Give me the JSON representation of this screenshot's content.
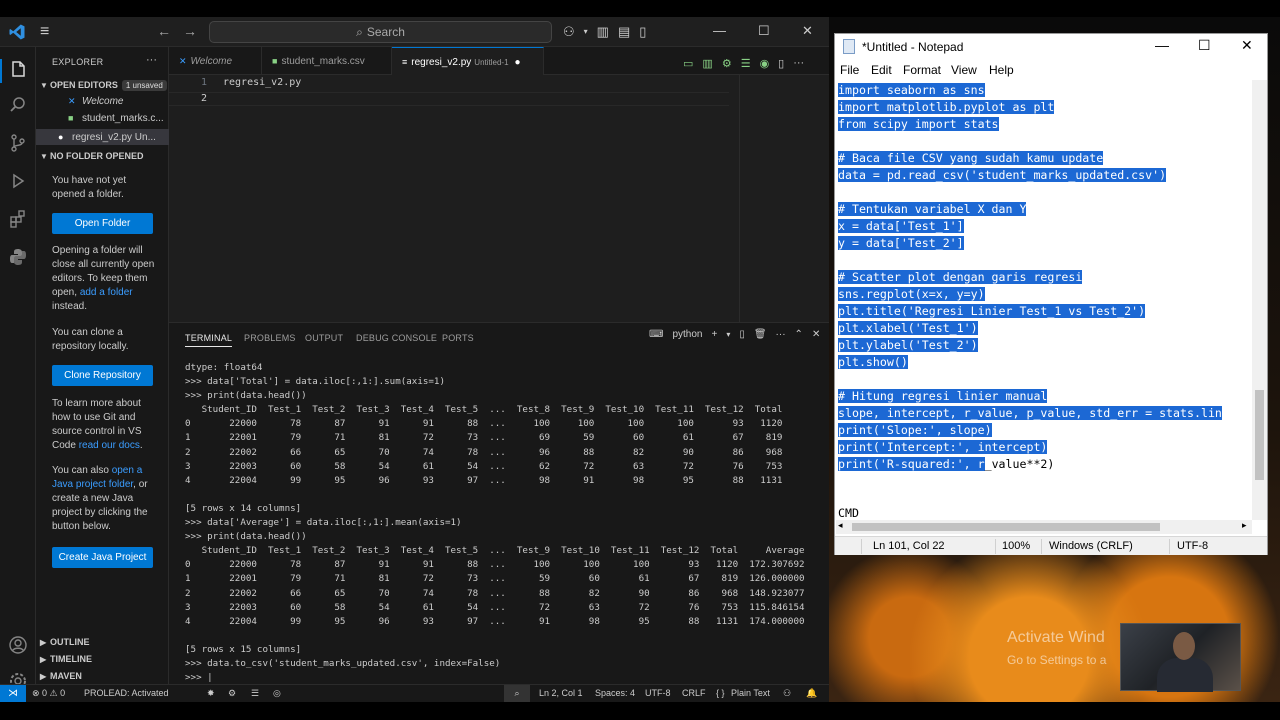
{
  "vscode": {
    "title_search": "Search",
    "explorer": {
      "title": "EXPLORER",
      "open_editors": "OPEN EDITORS",
      "unsaved_badge": "1 unsaved",
      "files": [
        "Welcome",
        "student_marks.c...",
        "regresi_v2.py Un..."
      ],
      "no_folder": "NO FOLDER OPENED",
      "msg_not_opened": "You have not yet opened a folder.",
      "open_folder_btn": "Open Folder",
      "msg_opening_1": "Opening a folder will close all currently open editors. To keep them open, ",
      "msg_opening_link": "add a folder",
      "msg_opening_2": " instead.",
      "msg_clone": "You can clone a repository locally.",
      "clone_btn": "Clone Repository",
      "msg_git_1": "To learn more about how to use Git and source control in VS Code ",
      "msg_git_link": "read our docs",
      "msg_git_2": ".",
      "msg_java_1": "You can also ",
      "msg_java_link": "open a Java project folder",
      "msg_java_2": ", or create a new Java project by clicking the button below.",
      "java_btn": "Create Java Project",
      "outline": "OUTLINE",
      "timeline": "TIMELINE",
      "maven": "MAVEN"
    },
    "tabs": {
      "welcome": "Welcome",
      "csv": "student_marks.csv",
      "py": "regresi_v2.py",
      "py_sub": "Untitled-1"
    },
    "editor": {
      "lines": [
        "regresi_v2.py",
        ""
      ]
    },
    "panel": {
      "tabs": [
        "TERMINAL",
        "PROBLEMS",
        "OUTPUT",
        "DEBUG CONSOLE",
        "PORTS"
      ],
      "shell": "python",
      "lines": [
        "dtype: float64",
        ">>> data['Total'] = data.iloc[:,1:].sum(axis=1)",
        ">>> print(data.head())",
        "   Student_ID  Test_1  Test_2  Test_3  Test_4  Test_5  ...  Test_8  Test_9  Test_10  Test_11  Test_12  Total",
        "0       22000      78      87      91      91      88  ...     100     100      100      100       93   1120",
        "1       22001      79      71      81      72      73  ...      69      59       60       61       67    819",
        "2       22002      66      65      70      74      78  ...      96      88       82       90       86    968",
        "3       22003      60      58      54      61      54  ...      62      72       63       72       76    753",
        "4       22004      99      95      96      93      97  ...      98      91       98       95       88   1131",
        "",
        "[5 rows x 14 columns]",
        ">>> data['Average'] = data.iloc[:,1:].mean(axis=1)",
        ">>> print(data.head())",
        "   Student_ID  Test_1  Test_2  Test_3  Test_4  Test_5  ...  Test_9  Test_10  Test_11  Test_12  Total     Average",
        "0       22000      78      87      91      91      88  ...     100      100      100       93   1120  172.307692",
        "1       22001      79      71      81      72      73  ...      59       60       61       67    819  126.000000",
        "2       22002      66      65      70      74      78  ...      88       82       90       86    968  148.923077",
        "3       22003      60      58      54      61      54  ...      72       63       72       76    753  115.846154",
        "4       22004      99      95      96      93      97  ...      91       98       95       88   1131  174.000000",
        "",
        "[5 rows x 15 columns]",
        ">>> data.to_csv('student_marks_updated.csv', index=False)",
        ">>> |"
      ]
    },
    "status": {
      "errors": "⊗ 0 ⚠ 0",
      "prolead": "PROLEAD: Activated",
      "pos": "Ln 2, Col 1",
      "spaces": "Spaces: 4",
      "enc": "UTF-8",
      "eol": "CRLF",
      "lang": "Plain Text"
    }
  },
  "notepad": {
    "title": "*Untitled - Notepad",
    "menu": [
      "File",
      "Edit",
      "Format",
      "View",
      "Help"
    ],
    "lines": [
      {
        "text": "import seaborn as sns",
        "hl": true
      },
      {
        "text": "import matplotlib.pyplot as plt",
        "hl": true
      },
      {
        "text": "from scipy import stats",
        "hl": true
      },
      {
        "text": "",
        "hl": true
      },
      {
        "text": "# Baca file CSV yang sudah kamu update",
        "hl": true
      },
      {
        "text": "data = pd.read_csv('student_marks_updated.csv')",
        "hl": true
      },
      {
        "text": "",
        "hl": true
      },
      {
        "text": "# Tentukan variabel X dan Y",
        "hl": true
      },
      {
        "text": "x = data['Test_1']",
        "hl": true
      },
      {
        "text": "y = data['Test_2']",
        "hl": true
      },
      {
        "text": "",
        "hl": true
      },
      {
        "text": "# Scatter plot dengan garis regresi",
        "hl": true
      },
      {
        "text": "sns.regplot(x=x, y=y)",
        "hl": true
      },
      {
        "text": "plt.title('Regresi Linier Test_1 vs Test_2')",
        "hl": true
      },
      {
        "text": "plt.xlabel('Test_1')",
        "hl": true
      },
      {
        "text": "plt.ylabel('Test_2')",
        "hl": true
      },
      {
        "text": "plt.show()",
        "hl": true
      },
      {
        "text": "",
        "hl": true
      },
      {
        "text": "# Hitung regresi linier manual",
        "hl": true
      },
      {
        "text": "slope, intercept, r_value, p_value, std_err = stats.lin",
        "hl": true
      },
      {
        "text": "print('Slope:', slope)",
        "hl": true
      },
      {
        "text": "print('Intercept:', intercept)",
        "hl": true
      },
      {
        "text": "print('R-squared:', r",
        "hl": true,
        "tail": "_value**2)"
      }
    ],
    "cmd": "CMD",
    "status": {
      "pos": "Ln 101, Col 22",
      "zoom": "100%",
      "eol": "Windows (CRLF)",
      "enc": "UTF-8"
    }
  },
  "desktop": {
    "activate_title": "Activate Wind",
    "activate_sub": "Go to Settings to a"
  }
}
